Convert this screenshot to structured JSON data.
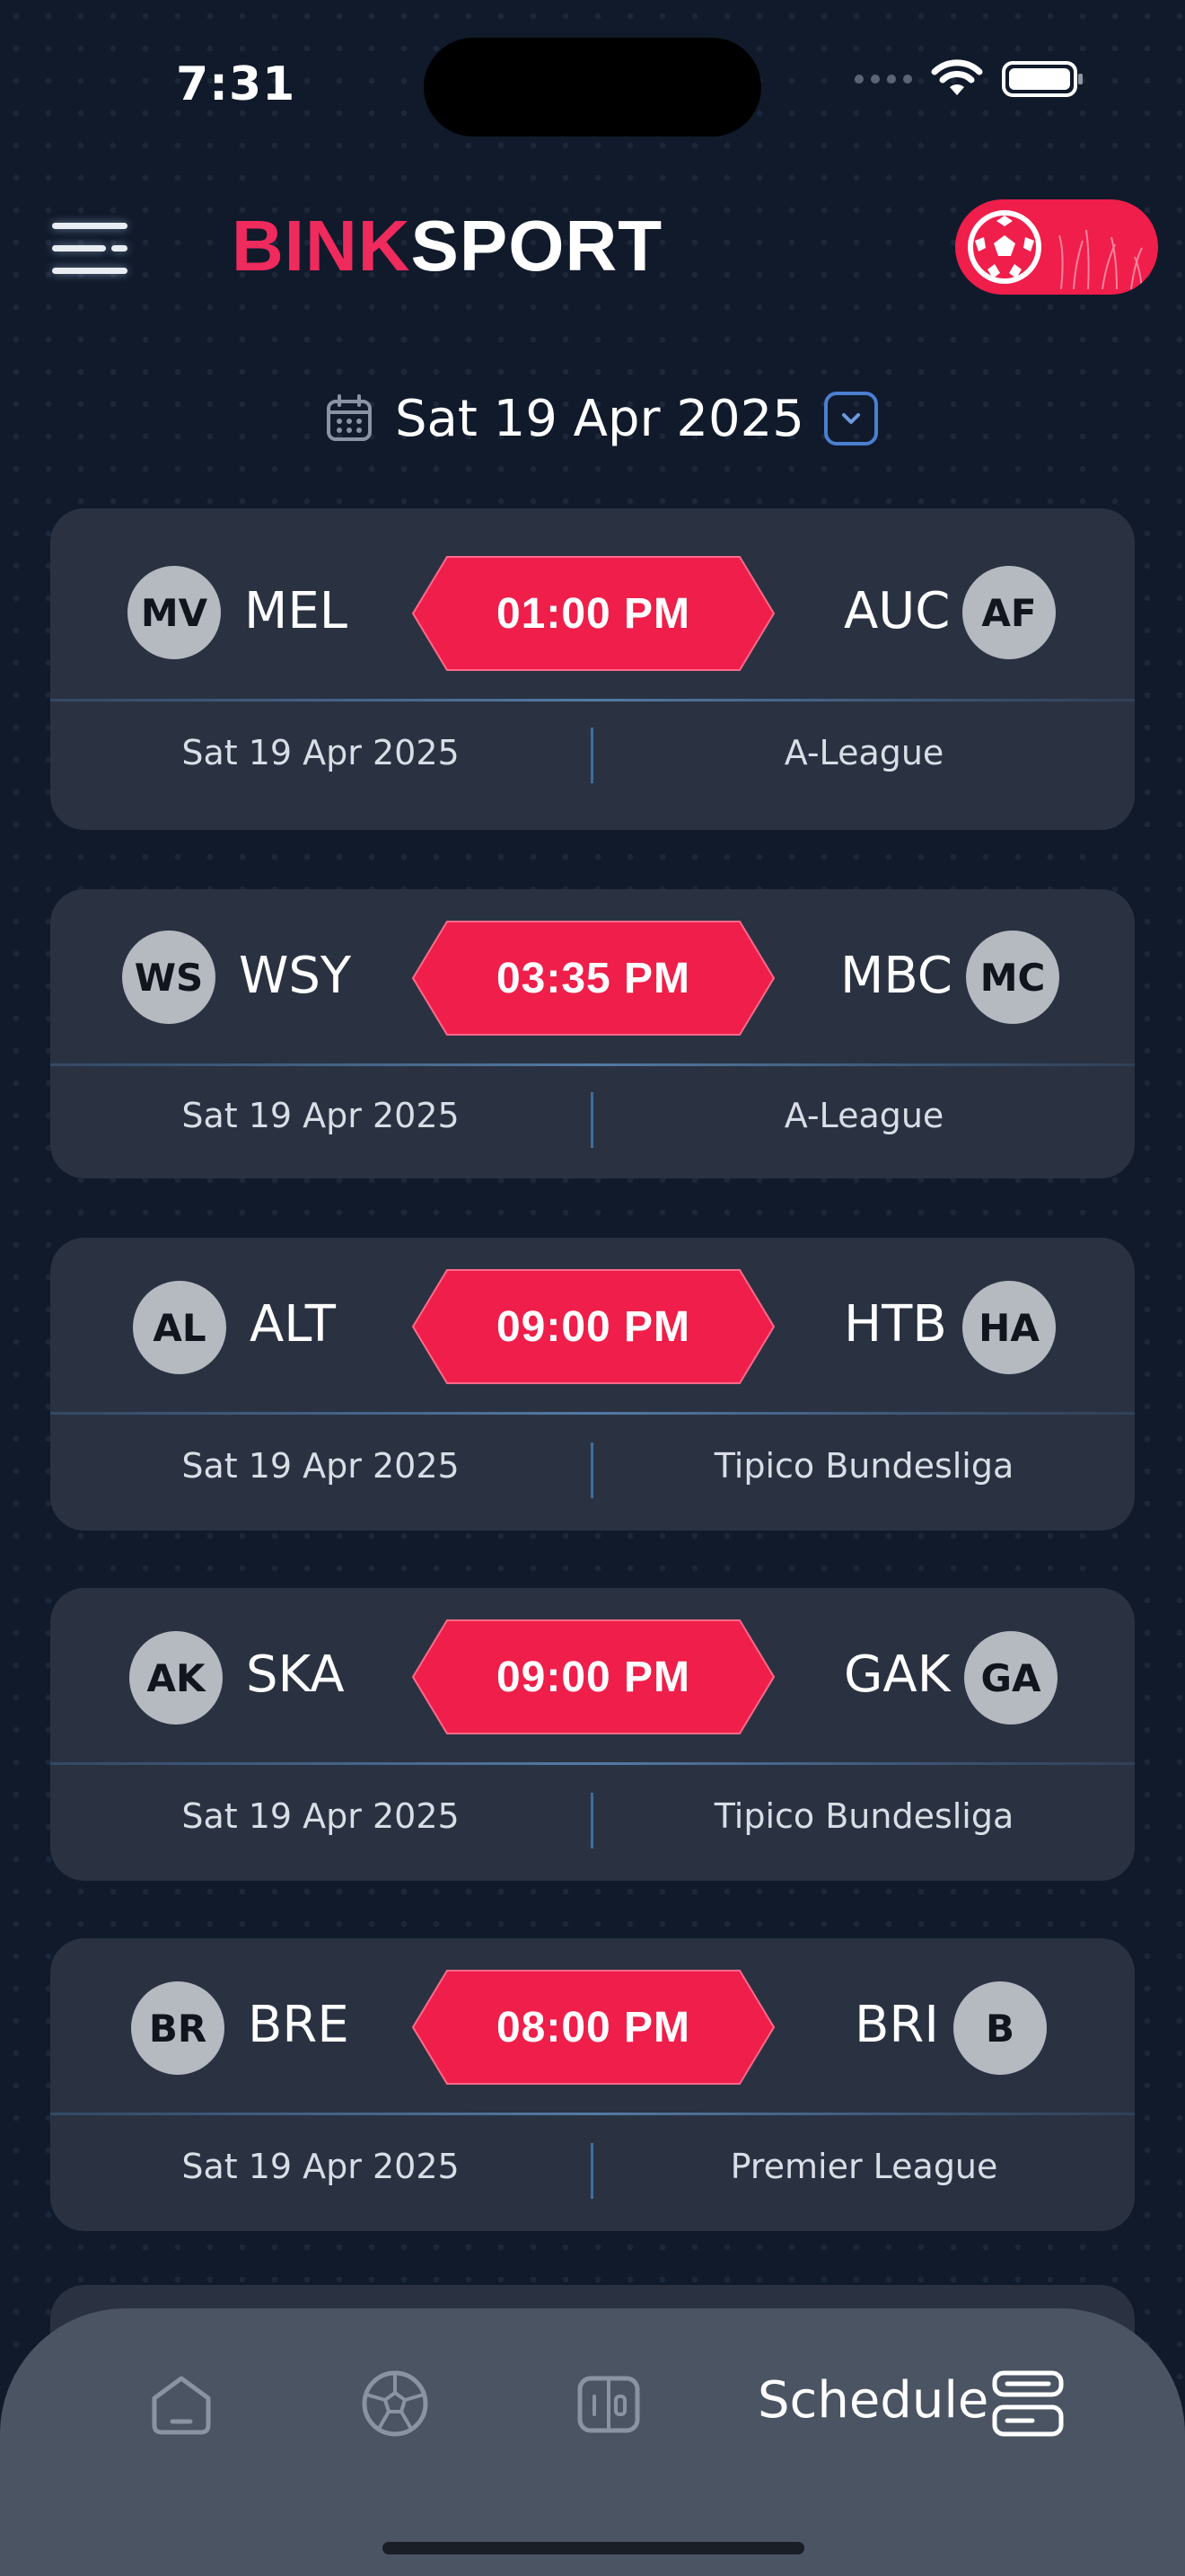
{
  "status_bar": {
    "time": "7:31"
  },
  "header": {
    "logo_part1": "BINK",
    "logo_part2": "SPORT"
  },
  "date_picker": {
    "date": "Sat 19 Apr 2025"
  },
  "matches": [
    {
      "home_badge": "MV",
      "home": "MEL",
      "time": "01:00 PM",
      "away": "AUC",
      "away_badge": "AF",
      "date": "Sat 19 Apr 2025",
      "league": "A-League"
    },
    {
      "home_badge": "WS",
      "home": "WSY",
      "time": "03:35 PM",
      "away": "MBC",
      "away_badge": "MC",
      "date": "Sat 19 Apr 2025",
      "league": "A-League"
    },
    {
      "home_badge": "AL",
      "home": "ALT",
      "time": "09:00 PM",
      "away": "HTB",
      "away_badge": "HA",
      "date": "Sat 19 Apr 2025",
      "league": "Tipico Bundesliga"
    },
    {
      "home_badge": "AK",
      "home": "SKA",
      "time": "09:00 PM",
      "away": "GAK",
      "away_badge": "GA",
      "date": "Sat 19 Apr 2025",
      "league": "Tipico Bundesliga"
    },
    {
      "home_badge": "BR",
      "home": "BRE",
      "time": "08:00 PM",
      "away": "BRI",
      "away_badge": "B",
      "date": "Sat 19 Apr 2025",
      "league": "Premier League"
    }
  ],
  "bottom_nav": {
    "items": [
      {
        "icon": "home-icon"
      },
      {
        "icon": "soccer-ball-icon"
      },
      {
        "icon": "scoreboard-icon"
      },
      {
        "icon": "schedule-icon",
        "label": "Schedule",
        "active": true
      }
    ]
  },
  "colors": {
    "accent": "#ef1e4a",
    "background": "#101a2b",
    "card": "#2a3242",
    "nav": "#4a5463"
  }
}
